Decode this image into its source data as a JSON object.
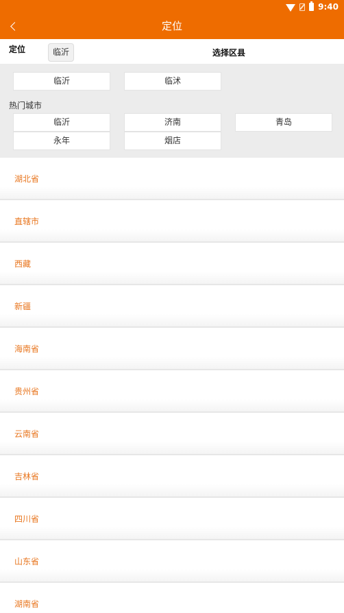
{
  "status_bar": {
    "time": "9:40",
    "icons": [
      "wifi-icon",
      "no-sim-icon",
      "battery-icon"
    ]
  },
  "app_bar": {
    "title": "定位",
    "back_icon": "chevron-left-icon"
  },
  "location": {
    "label": "定位",
    "current_city": "临沂",
    "district_heading": "选择区县"
  },
  "district_options": [
    "临沂",
    "临沭"
  ],
  "hot_cities": {
    "label": "热门城市",
    "cities": [
      "临沂",
      "济南",
      "青岛",
      "永年",
      "烟店"
    ]
  },
  "provinces": [
    "湖北省",
    "直辖市",
    "西藏",
    "新疆",
    "海南省",
    "贵州省",
    "云南省",
    "吉林省",
    "四川省",
    "山东省",
    "湖南省"
  ],
  "colors": {
    "accent": "#ee6c00",
    "province_text": "#e8761f"
  }
}
